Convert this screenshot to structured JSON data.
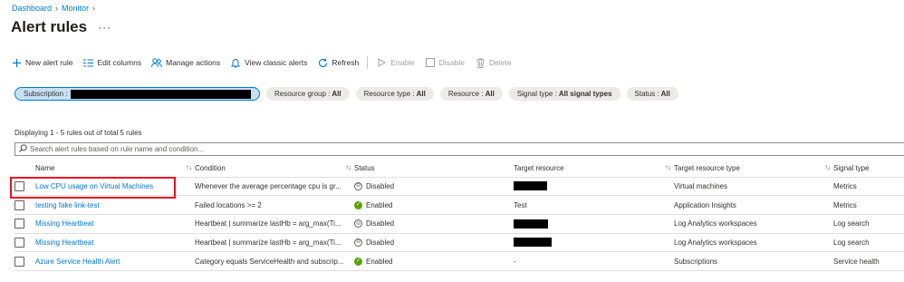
{
  "breadcrumb": [
    "Dashboard",
    "Monitor"
  ],
  "page_title": "Alert rules",
  "more_label": "···",
  "toolbar": {
    "new_alert_rule": "New alert rule",
    "edit_columns": "Edit columns",
    "manage_actions": "Manage actions",
    "view_classic_alerts": "View classic alerts",
    "refresh": "Refresh",
    "enable": "Enable",
    "disable": "Disable",
    "delete": "Delete"
  },
  "filters": {
    "subscription_label": "Subscription :",
    "resource_group_label": "Resource group :",
    "resource_group_value": "All",
    "resource_type_label": "Resource type :",
    "resource_type_value": "All",
    "resource_label": "Resource :",
    "resource_value": "All",
    "signal_type_label": "Signal type :",
    "signal_type_value": "All signal types",
    "status_label": "Status :",
    "status_value": "All"
  },
  "count_text": "Displaying 1 - 5 rules out of total 5 rules",
  "search": {
    "placeholder": "Search alert rules based on rule name and condition..."
  },
  "table": {
    "headers": {
      "name": "Name",
      "condition": "Condition",
      "status": "Status",
      "target_resource": "Target resource",
      "target_resource_type": "Target resource type",
      "signal_type": "Signal type"
    },
    "rows": [
      {
        "name": "Low CPU usage on Virtual Machines",
        "condition": "Whenever the average percentage cpu is gr...",
        "status": "Disabled",
        "status_kind": "disabled",
        "target": "",
        "target_redacted": true,
        "target_type": "Virtual machines",
        "signal": "Metrics"
      },
      {
        "name": "testing fake link-test",
        "condition": "Failed locations >= 2",
        "status": "Enabled",
        "status_kind": "enabled",
        "target": "Test",
        "target_redacted": false,
        "target_type": "Application Insights",
        "signal": "Metrics"
      },
      {
        "name": "Missing Heartbeat",
        "condition": "Heartbeat | summarize lastHb = arg_max(Ti...",
        "status": "Disabled",
        "status_kind": "disabled",
        "target": "",
        "target_redacted": true,
        "target_type": "Log Analytics workspaces",
        "signal": "Log search"
      },
      {
        "name": "Missing Heartbeat",
        "condition": "Heartbeat | summarize lastHb = arg_max(Ti...",
        "status": "Disabled",
        "status_kind": "disabled",
        "target": "",
        "target_redacted": true,
        "target_type": "Log Analytics workspaces",
        "signal": "Log search"
      },
      {
        "name": "Azure Service Health Alert",
        "condition": "Category equals ServiceHealth and subscrip...",
        "status": "Enabled",
        "status_kind": "enabled",
        "target": "-",
        "target_redacted": false,
        "target_type": "Subscriptions",
        "signal": "Service health"
      }
    ]
  },
  "colors": {
    "link": "#0078d4",
    "enabled": "#57a300",
    "highlight": "#e81123"
  }
}
